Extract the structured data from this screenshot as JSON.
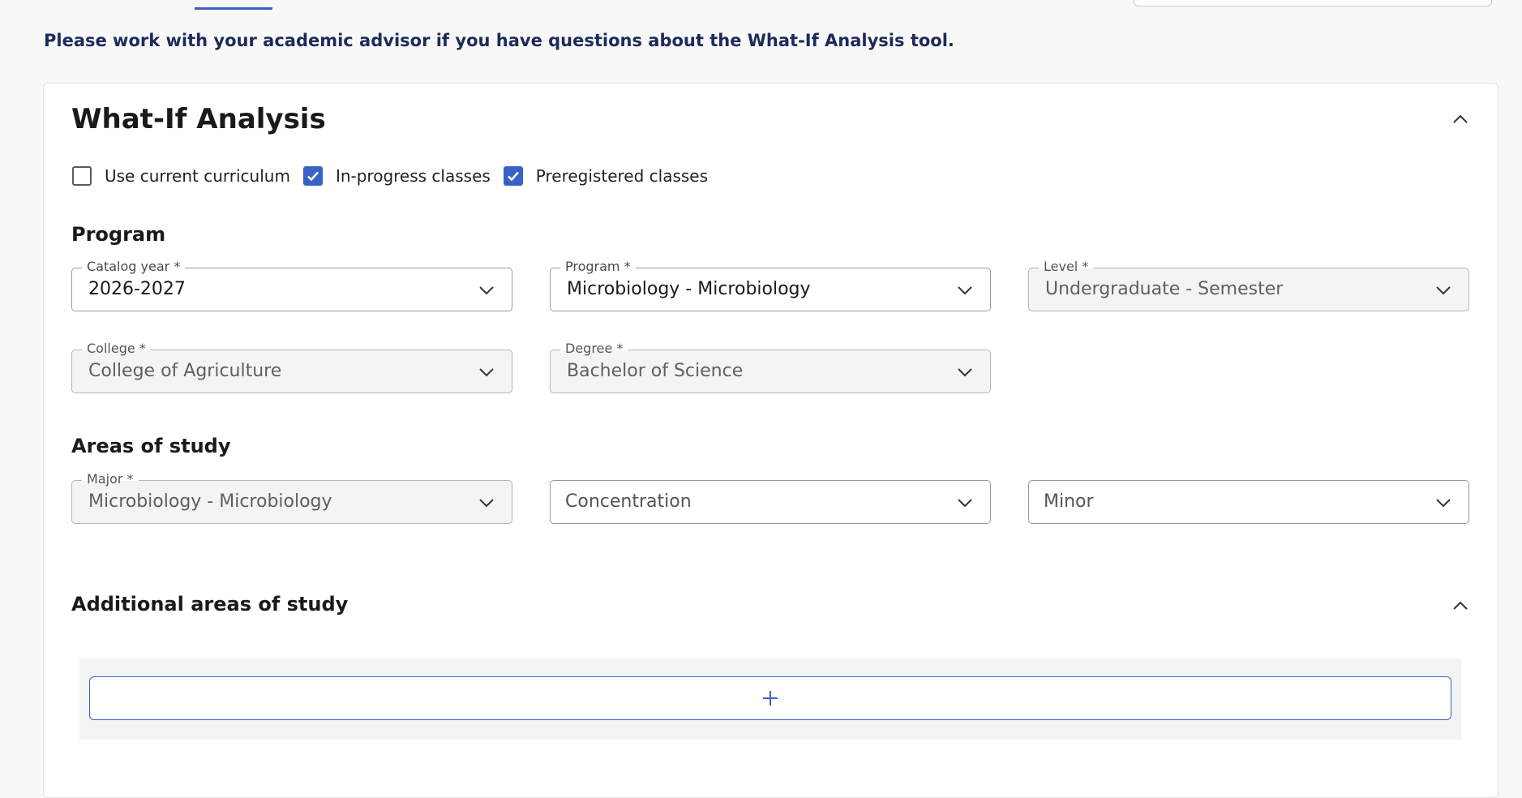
{
  "notice": "Please work with your academic advisor if you have questions about the What-If Analysis tool.",
  "card": {
    "title": "What-If Analysis",
    "options": [
      {
        "label": "Use current curriculum",
        "checked": false
      },
      {
        "label": "In-progress classes",
        "checked": true
      },
      {
        "label": "Preregistered classes",
        "checked": true
      }
    ]
  },
  "program_section": {
    "title": "Program",
    "catalog_year": {
      "label": "Catalog year *",
      "value": "2026-2027"
    },
    "program": {
      "label": "Program *",
      "value": "Microbiology - Microbiology"
    },
    "level": {
      "label": "Level *",
      "value": "Undergraduate - Semester"
    },
    "college": {
      "label": "College *",
      "value": "College of Agriculture"
    },
    "degree": {
      "label": "Degree *",
      "value": "Bachelor of Science"
    }
  },
  "areas_section": {
    "title": "Areas of study",
    "major": {
      "label": "Major *",
      "value": "Microbiology - Microbiology"
    },
    "concentration": {
      "placeholder": "Concentration"
    },
    "minor": {
      "placeholder": "Minor"
    }
  },
  "additional_section": {
    "title": "Additional areas of study",
    "add_icon": "plus-icon"
  },
  "colors": {
    "accent": "#3a62c6",
    "notice_text": "#1d2a5a"
  }
}
